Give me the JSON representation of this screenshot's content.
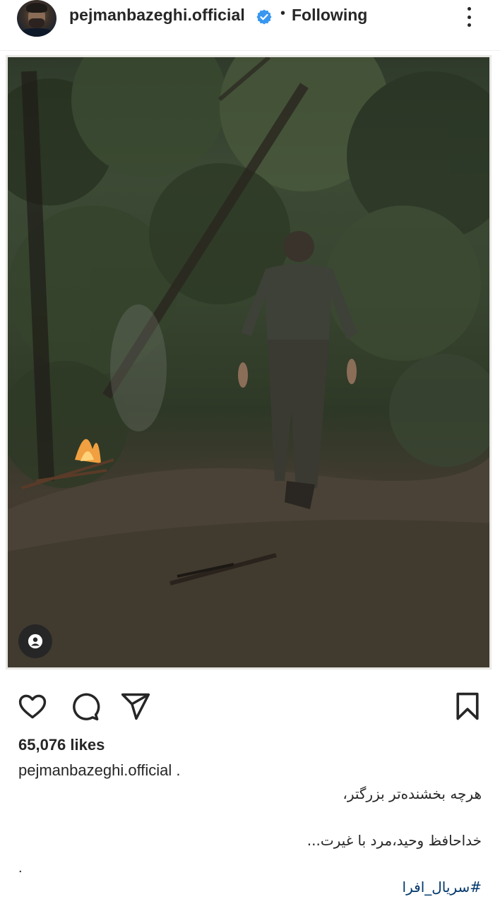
{
  "header": {
    "username": "pejmanbazeghi.official",
    "separator": "•",
    "follow_status": "Following"
  },
  "post": {
    "likes": "65,076 likes",
    "caption_user": "pejmanbazeghi.official",
    "caption_user_suffix": ".",
    "caption_lines": [
      "هرچه بخشنده‌تر بزرگتر،",
      "خداحافظ وحید،مرد با غیرت..."
    ],
    "caption_dot": ".",
    "hashtag": "#سریال_افرا"
  },
  "icons": {
    "verified": "verified-badge-icon",
    "more": "more-options-icon",
    "like": "heart-icon",
    "comment": "comment-icon",
    "share": "send-icon",
    "save": "bookmark-icon",
    "tag": "user-tag-icon"
  },
  "colors": {
    "verified_blue": "#3897f0",
    "text": "#262626",
    "hashtag": "#00376b"
  }
}
